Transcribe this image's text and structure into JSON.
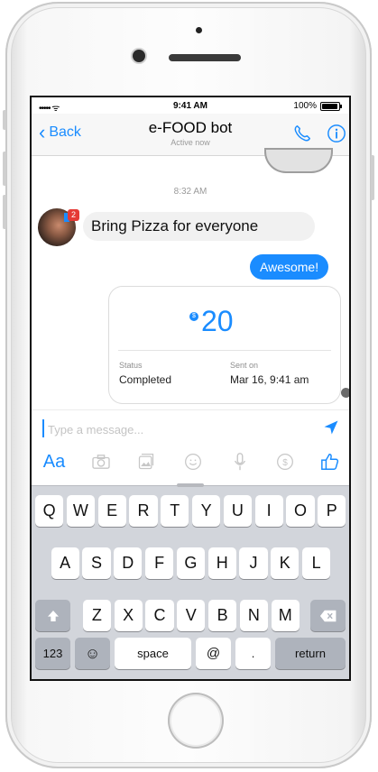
{
  "status_bar": {
    "signal": "•••••",
    "wifi": "ᯤ",
    "time": "9:41 AM",
    "battery": "100%"
  },
  "nav": {
    "back_label": "Back",
    "title": "e-FOOD bot",
    "subtitle": "Active now"
  },
  "chat": {
    "timestamp": "8:32 AM",
    "incoming_badge": "2",
    "incoming_message": "Bring Pizza for everyone",
    "outgoing_message": "Awesome!",
    "payment": {
      "currency_icon": "$",
      "amount": "20",
      "status_label": "Status",
      "status_value": "Completed",
      "sent_label": "Sent on",
      "sent_value": "Mar 16, 9:41 am"
    }
  },
  "composer": {
    "placeholder": "Type a message...",
    "aa_label": "Aa"
  },
  "keyboard": {
    "row1": [
      "Q",
      "W",
      "E",
      "R",
      "T",
      "Y",
      "U",
      "I",
      "O",
      "P"
    ],
    "row2": [
      "A",
      "S",
      "D",
      "F",
      "G",
      "H",
      "J",
      "K",
      "L"
    ],
    "row3": [
      "Z",
      "X",
      "C",
      "V",
      "B",
      "N",
      "M"
    ],
    "numbers_label": "123",
    "emoji_label": "☺",
    "space_label": "space",
    "at_label": "@",
    "dot_label": ".",
    "return_label": "return"
  },
  "colors": {
    "accent": "#1a8cff",
    "badge": "#e53935",
    "keyboard_bg": "#d2d5db"
  }
}
